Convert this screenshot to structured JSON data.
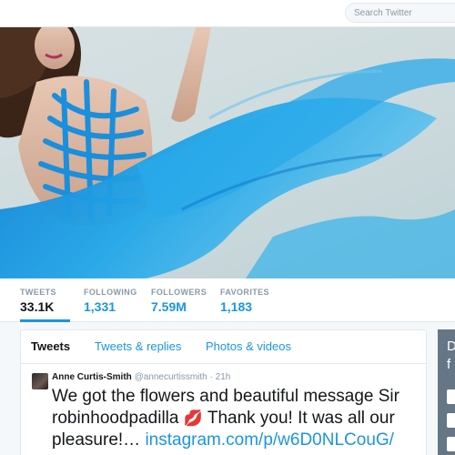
{
  "search": {
    "placeholder": "Search Twitter"
  },
  "profile": {
    "stats": [
      {
        "label": "TWEETS",
        "value": "33.1K"
      },
      {
        "label": "FOLLOWING",
        "value": "1,331"
      },
      {
        "label": "FOLLOWERS",
        "value": "7.59M"
      },
      {
        "label": "FAVORITES",
        "value": "1,183"
      }
    ]
  },
  "timeline": {
    "tabs": [
      "Tweets",
      "Tweets & replies",
      "Photos & videos"
    ],
    "tweet": {
      "name": "Anne Curtis-Smith",
      "handle": "@annecurtissmith",
      "time": "· 21h",
      "text_part1": "We got the flowers and beautiful message Sir robinhoodpadilla ",
      "emoji": "💋",
      "text_part2": " Thank you! It was all our pleasure!… ",
      "link": "instagram.com/p/w6D0NLCouG/"
    }
  },
  "sidebar_partial": {
    "char1": "D",
    "char2": "f"
  },
  "colors": {
    "accent": "#1b95e0",
    "banner_dress": "#1ea3e6"
  },
  "icons": {
    "avatar": "user-avatar",
    "emoji": "kiss-mark-icon"
  }
}
